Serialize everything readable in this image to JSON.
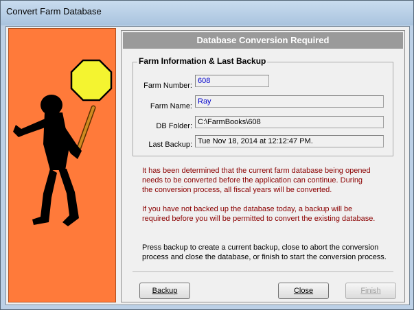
{
  "window": {
    "title": "Convert Farm Database"
  },
  "header": {
    "title": "Database Conversion Required"
  },
  "farm_info": {
    "legend": "Farm Information & Last Backup",
    "fields": [
      {
        "label": "Farm Number:",
        "value": "608"
      },
      {
        "label": "Farm Name:",
        "value": "Ray"
      },
      {
        "label": "DB Folder:",
        "value": "C:\\FarmBooks\\608"
      },
      {
        "label": "Last Backup:",
        "value": "Tue Nov 18, 2014 at 12:12:47 PM."
      }
    ]
  },
  "messages": {
    "conversion": [
      "It has been determined that the current farm database being opened",
      "needs to be converted before the application can continue.  During",
      "the conversion process, all fiscal years will be converted."
    ],
    "backup": [
      "If you have not backed up the database today, a backup will be",
      "required before you will be permitted to convert the existing database."
    ],
    "instructions": [
      "Press backup to create a current backup, close to abort the conversion",
      "process and close the database, or finish to start the conversion process."
    ]
  },
  "buttons": {
    "backup": "Backup",
    "close": "Close",
    "finish": "Finish"
  },
  "colors": {
    "art_background": "#ff7a3a",
    "header_bar": "#9a9a9a",
    "message_red": "#8b0000",
    "value_blue": "#0000cc"
  },
  "art": {
    "icon": "stop-sign-figure"
  }
}
